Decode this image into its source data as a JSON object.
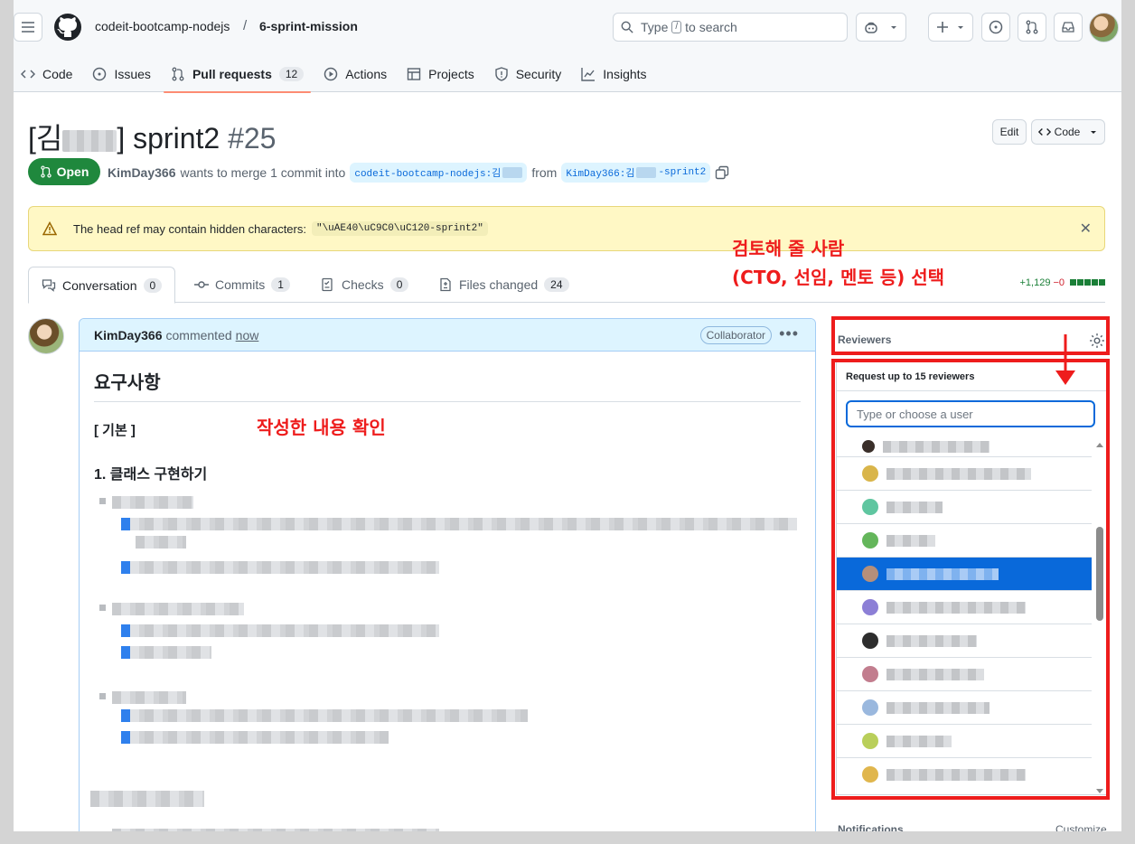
{
  "header": {
    "owner": "codeit-bootcamp-nodejs",
    "separator": "/",
    "repo": "6-sprint-mission",
    "search_prefix": "Type",
    "search_key": "/",
    "search_suffix": "to search"
  },
  "repo_nav": [
    {
      "label": "Code",
      "icon": "code-icon"
    },
    {
      "label": "Issues",
      "icon": "issue-icon"
    },
    {
      "label": "Pull requests",
      "icon": "pull-request-icon",
      "count": "12"
    },
    {
      "label": "Actions",
      "icon": "play-icon"
    },
    {
      "label": "Projects",
      "icon": "table-icon"
    },
    {
      "label": "Security",
      "icon": "shield-icon"
    },
    {
      "label": "Insights",
      "icon": "graph-icon"
    }
  ],
  "pr": {
    "title_prefix": "[김",
    "title_suffix": "] sprint2",
    "number": "#25",
    "edit_label": "Edit",
    "code_label": "Code",
    "state": "Open",
    "author": "KimDay366",
    "merge_text": "wants to merge 1 commit into",
    "base_branch": "codeit-bootcamp-nodejs:김",
    "from_text": "from",
    "head_branch_prefix": "KimDay366:김",
    "head_branch_suffix": "-sprint2"
  },
  "warning": {
    "text": "The head ref may contain hidden characters:",
    "code": "\"\\uAE40\\uC9C0\\uC120-sprint2\""
  },
  "pr_tabs": [
    {
      "label": "Conversation",
      "count": "0",
      "icon": "comment-discussion-icon"
    },
    {
      "label": "Commits",
      "count": "1",
      "icon": "commit-icon"
    },
    {
      "label": "Checks",
      "count": "0",
      "icon": "checklist-icon"
    },
    {
      "label": "Files changed",
      "count": "24",
      "icon": "file-diff-icon"
    }
  ],
  "diffstat": {
    "additions": "+1,129",
    "deletions": "−0"
  },
  "comment": {
    "author": "KimDay366",
    "action": "commented",
    "time": "now",
    "badge": "Collaborator",
    "heading": "요구사항",
    "section": "[ 기본 ]",
    "item": "1. 클래스 구현하기"
  },
  "annotations": {
    "content": "작성한 내용 확인",
    "reviewer_line1": "검토해 줄 사람",
    "reviewer_line2": "(CTO, 선임, 멘토 등) 선택",
    "color": "#ee1c1c"
  },
  "sidebar": {
    "reviewers_label": "Reviewers",
    "picker_title": "Request up to 15 reviewers",
    "picker_placeholder": "Type or choose a user",
    "selected_index": 4,
    "notifications_label": "Notifications",
    "customize_label": "Customize"
  },
  "colors": {
    "accent": "#0969da",
    "open_green": "#1f883d",
    "nav_underline": "#fd8c73"
  }
}
